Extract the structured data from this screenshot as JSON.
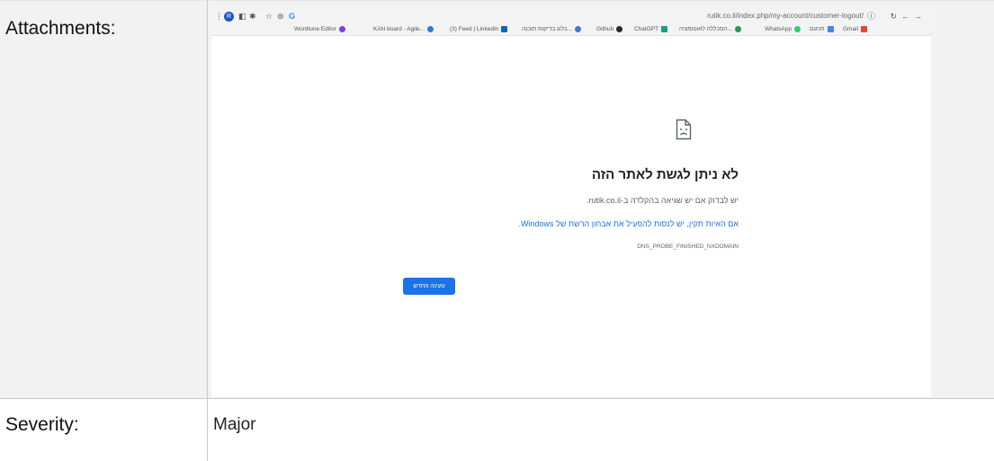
{
  "labels": {
    "attachments": "Attachments:",
    "severity": "Severity:"
  },
  "severity_value": "Major",
  "screenshot": {
    "url": "rutik.co.il/index.php/my-account/customer-logout/",
    "avatar": "R",
    "bookmarks": [
      {
        "label": "Wordtune Editor",
        "color": "#7b3fe4"
      },
      {
        "label": "KAN board - Agile...",
        "color": "#2a7de1"
      },
      {
        "label": "(3) Feed | LinkedIn",
        "color": "#0a66c2"
      },
      {
        "label": "בלוג בדיקות תוכנה...",
        "color": "#3c7ad6"
      },
      {
        "label": "Github",
        "color": "#24292e"
      },
      {
        "label": "ChatGPT",
        "color": "#10a37f"
      },
      {
        "label": "המכללה לאוטומציה...",
        "color": "#1e9e4a"
      },
      {
        "label": "WhatsApp",
        "color": "#25d366"
      },
      {
        "label": "תרגום",
        "color": "#4285f4"
      },
      {
        "label": "Gmail",
        "color": "#ea4335"
      }
    ],
    "error_title": "לא ניתן לגשת לאתר הזה",
    "error_line1": "יש לבדוק אם יש שגיאה בהקלדה ב-rutik.co.il.",
    "error_line2": "אם האיות תקין, יש לנסות להפעיל את אבחון הרשת של Windows.",
    "error_code": "DNS_PROBE_FINISHED_NXDOMAIN",
    "reload_label": "טעינה מחדש"
  },
  "colors": {
    "chrome_blue": "#1a73e8",
    "row_shade": "#f2f2f2"
  }
}
